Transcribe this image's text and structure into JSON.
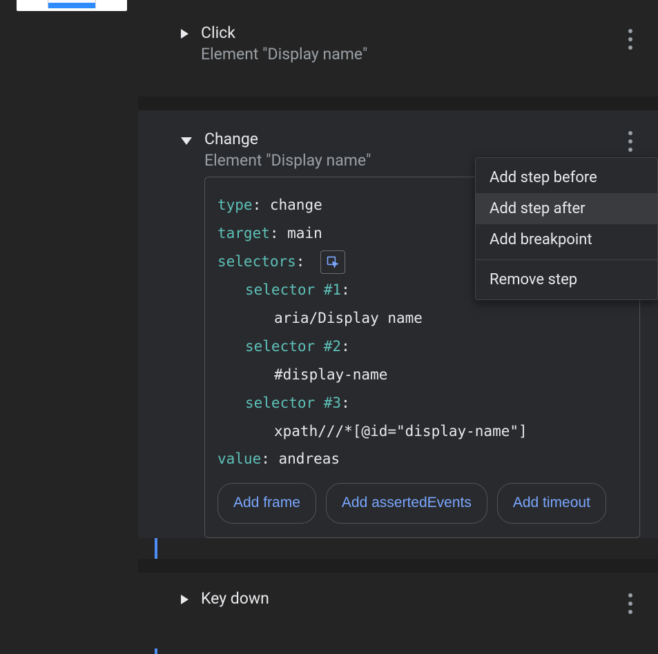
{
  "steps": [
    {
      "id": "click",
      "title": "Click",
      "subtitle": "Element \"Display name\"",
      "expanded": false
    },
    {
      "id": "change",
      "title": "Change",
      "subtitle": "Element \"Display name\"",
      "expanded": true,
      "details": {
        "type_label": "type",
        "type_value": "change",
        "target_label": "target",
        "target_value": "main",
        "selectors_label": "selectors",
        "selectors": [
          {
            "label": "selector #1",
            "value": "aria/Display name"
          },
          {
            "label": "selector #2",
            "value": "#display-name"
          },
          {
            "label": "selector #3",
            "value": "xpath///*[@id=\"display-name\"]"
          }
        ],
        "value_label": "value",
        "value_value": "andreas",
        "chips": [
          "Add frame",
          "Add assertedEvents",
          "Add timeout"
        ]
      }
    },
    {
      "id": "keydown",
      "title": "Key down",
      "subtitle": "",
      "expanded": false
    }
  ],
  "context_menu": {
    "items": [
      {
        "key": "before",
        "label": "Add step before"
      },
      {
        "key": "after",
        "label": "Add step after",
        "hover": true
      },
      {
        "key": "breakpoint",
        "label": "Add breakpoint"
      },
      {
        "key": "remove",
        "label": "Remove step"
      }
    ]
  }
}
